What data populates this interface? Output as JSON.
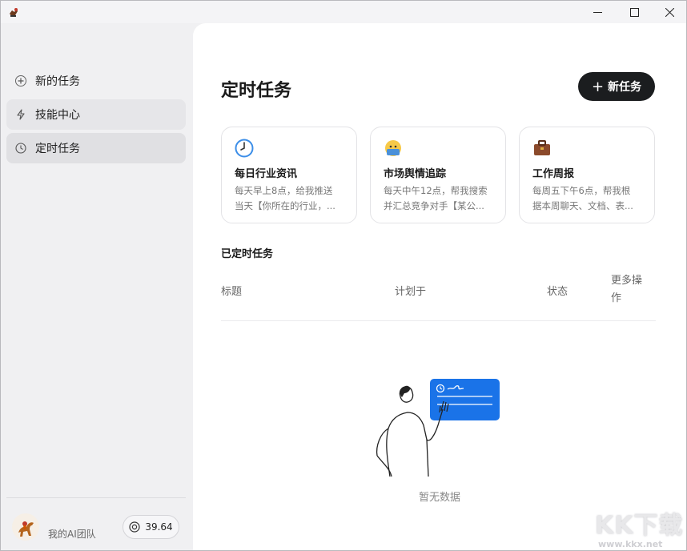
{
  "window": {
    "minimize_glyph": "—",
    "maximize_glyph": "☐",
    "close_glyph": "✕"
  },
  "sidebar": {
    "items": [
      {
        "label": "新的任务",
        "icon": "plus-icon"
      },
      {
        "label": "技能中心",
        "icon": "lightning-icon"
      },
      {
        "label": "定时任务",
        "icon": "clock-icon"
      }
    ],
    "team_label": "我的AI团队",
    "credits": "39.64"
  },
  "main": {
    "title": "定时任务",
    "new_task_label": "新任务",
    "cards": [
      {
        "icon": "clock-emoji-icon",
        "title": "每日行业资讯",
        "desc_line1": "每天早上8点，给我推送",
        "desc_line2": "当天【你所在的行业，..."
      },
      {
        "icon": "worried-face-icon",
        "title": "市场舆情追踪",
        "desc_line1": "每天中午12点，帮我搜索",
        "desc_line2": "并汇总竞争对手【某公..."
      },
      {
        "icon": "briefcase-icon",
        "title": "工作周报",
        "desc_line1": "每周五下午6点，帮我根",
        "desc_line2": "据本周聊天、文档、表..."
      }
    ],
    "section_title": "已定时任务",
    "columns": {
      "title": "标题",
      "plan": "计划于",
      "status": "状态",
      "more": "更多操作"
    },
    "empty_text": "暂无数据"
  },
  "watermark": {
    "main": "KK下载",
    "url": "www.kkx.net"
  },
  "colors": {
    "accent_dark": "#1b1d1f",
    "illustration_blue": "#1a73e8",
    "sidebar_bg": "#f0f0f2",
    "main_bg": "#ffffff"
  }
}
